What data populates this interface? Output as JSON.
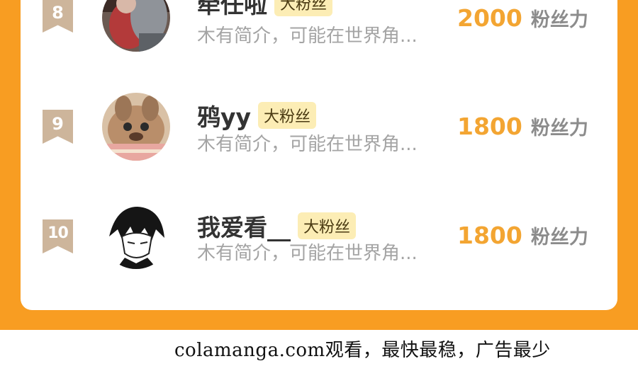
{
  "ranking": [
    {
      "rank": "8",
      "name": "牵任啦",
      "tag": "大粉丝",
      "bio": "木有简介，可能在世界角...",
      "score": "2000",
      "score_unit": "粉丝力"
    },
    {
      "rank": "9",
      "name": "鸦yy",
      "tag": "大粉丝",
      "bio": "木有简介，可能在世界角...",
      "score": "1800",
      "score_unit": "粉丝力"
    },
    {
      "rank": "10",
      "name": "我爱看__",
      "tag": "大粉丝",
      "bio": "木有简介，可能在世界角...",
      "score": "1800",
      "score_unit": "粉丝力"
    }
  ],
  "footer": {
    "watermark": "colamanga.com观看，最快最稳，广告最少"
  },
  "colors": {
    "frame_orange": "#f89d22",
    "score_orange": "#f3a532",
    "tag_background": "#fcedb5",
    "rank_badge": "#cdb59b"
  }
}
